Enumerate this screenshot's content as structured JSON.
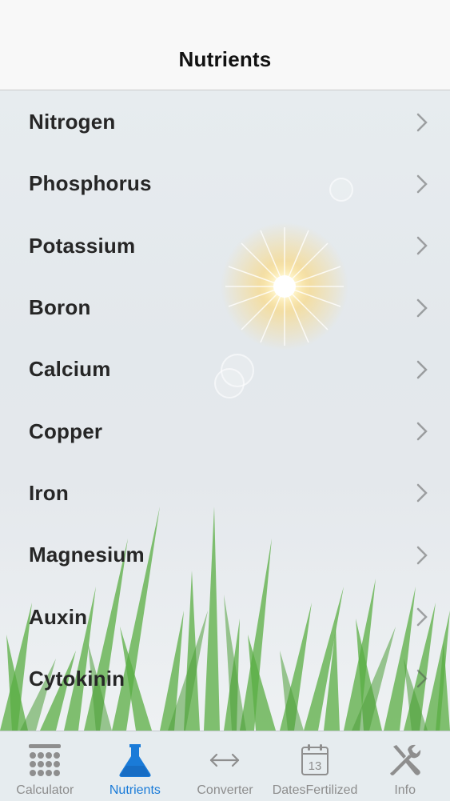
{
  "header": {
    "title": "Nutrients"
  },
  "nutrients": [
    {
      "label": "Nitrogen"
    },
    {
      "label": "Phosphorus"
    },
    {
      "label": "Potassium"
    },
    {
      "label": "Boron"
    },
    {
      "label": "Calcium"
    },
    {
      "label": "Copper"
    },
    {
      "label": "Iron"
    },
    {
      "label": "Magnesium"
    },
    {
      "label": "Auxin"
    },
    {
      "label": "Cytokinin"
    }
  ],
  "tabs": [
    {
      "label": "Calculator",
      "icon": "calculator-icon"
    },
    {
      "label": "Nutrients",
      "icon": "flask-icon",
      "active": true
    },
    {
      "label": "Converter",
      "icon": "double-arrow-icon"
    },
    {
      "label": "DatesFertilized",
      "icon": "calendar-icon"
    },
    {
      "label": "Info",
      "icon": "tools-icon"
    }
  ],
  "calendar_day": "13",
  "colors": {
    "accent": "#1a7bd8",
    "grass": "#5aad43",
    "sun": "#ffd56a"
  }
}
